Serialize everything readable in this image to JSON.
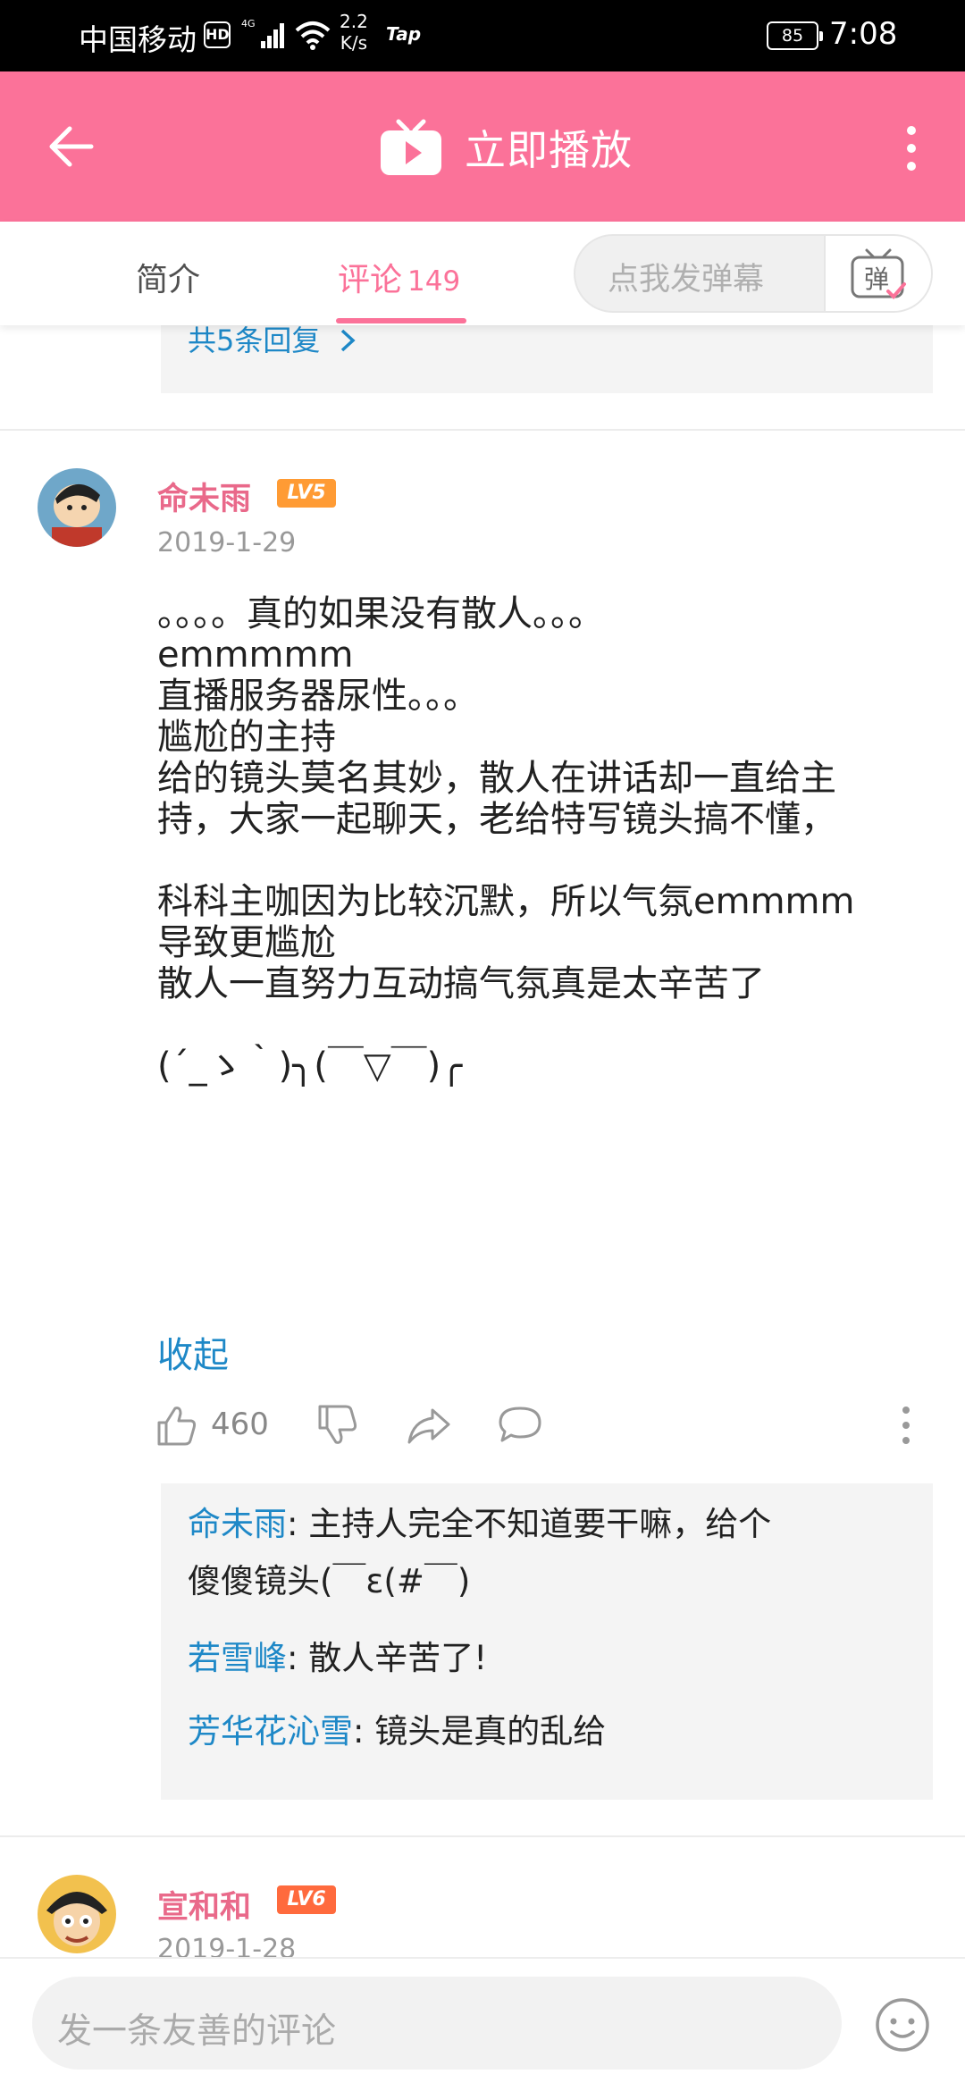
{
  "status_bar": {
    "carrier": "中国移动",
    "hd": "HD",
    "network": "4G",
    "speed_value": "2.2",
    "speed_unit": "K/s",
    "tap_label": "Tap",
    "battery": "85",
    "time": "7:08"
  },
  "header": {
    "title": "立即播放"
  },
  "tabs": {
    "intro": "简介",
    "comments": "评论",
    "comments_count": "149",
    "danmaku_placeholder": "点我发弹幕",
    "danmaku_button": "弹"
  },
  "previous_comment": {
    "more_replies": "共5条回复"
  },
  "comment": {
    "username": "命未雨",
    "level": "LV5",
    "date": "2019-1-29",
    "body_lines": [
      "。。。。真的如果没有散人。。。",
      "emmmmm",
      "直播服务器尿性。。。",
      "尴尬的主持",
      "给的镜头莫名其妙，散人在讲话却一直给主",
      "持，大家一起聊天，老给特写镜头搞不懂，",
      "",
      "科科主咖因为比较沉默，所以气氛emmmm",
      "导致更尴尬",
      "散人一直努力互动搞气氛真是太辛苦了",
      "",
      "(´_ゝ｀)╮(￣▽￣)╭"
    ],
    "collapse": "收起",
    "likes": "460",
    "replies": [
      {
        "user": "命未雨",
        "sep": ": ",
        "text": "主持人完全不知道要干嘛，给个",
        "text2": "傻傻镜头(￣ε(#￣)"
      },
      {
        "user": "若雪峰",
        "sep": ": ",
        "text": "散人辛苦了!"
      },
      {
        "user": "芳华花沁雪",
        "sep": ": ",
        "text": "镜头是真的乱给"
      }
    ]
  },
  "next_comment": {
    "username": "宣和和",
    "level": "LV6",
    "date": "2019-1-28"
  },
  "bottom_bar": {
    "placeholder": "发一条友善的评论"
  },
  "colors": {
    "brand_pink": "#fb7299",
    "link_blue": "#1e88c7",
    "level_orange": "#ff9b34"
  }
}
